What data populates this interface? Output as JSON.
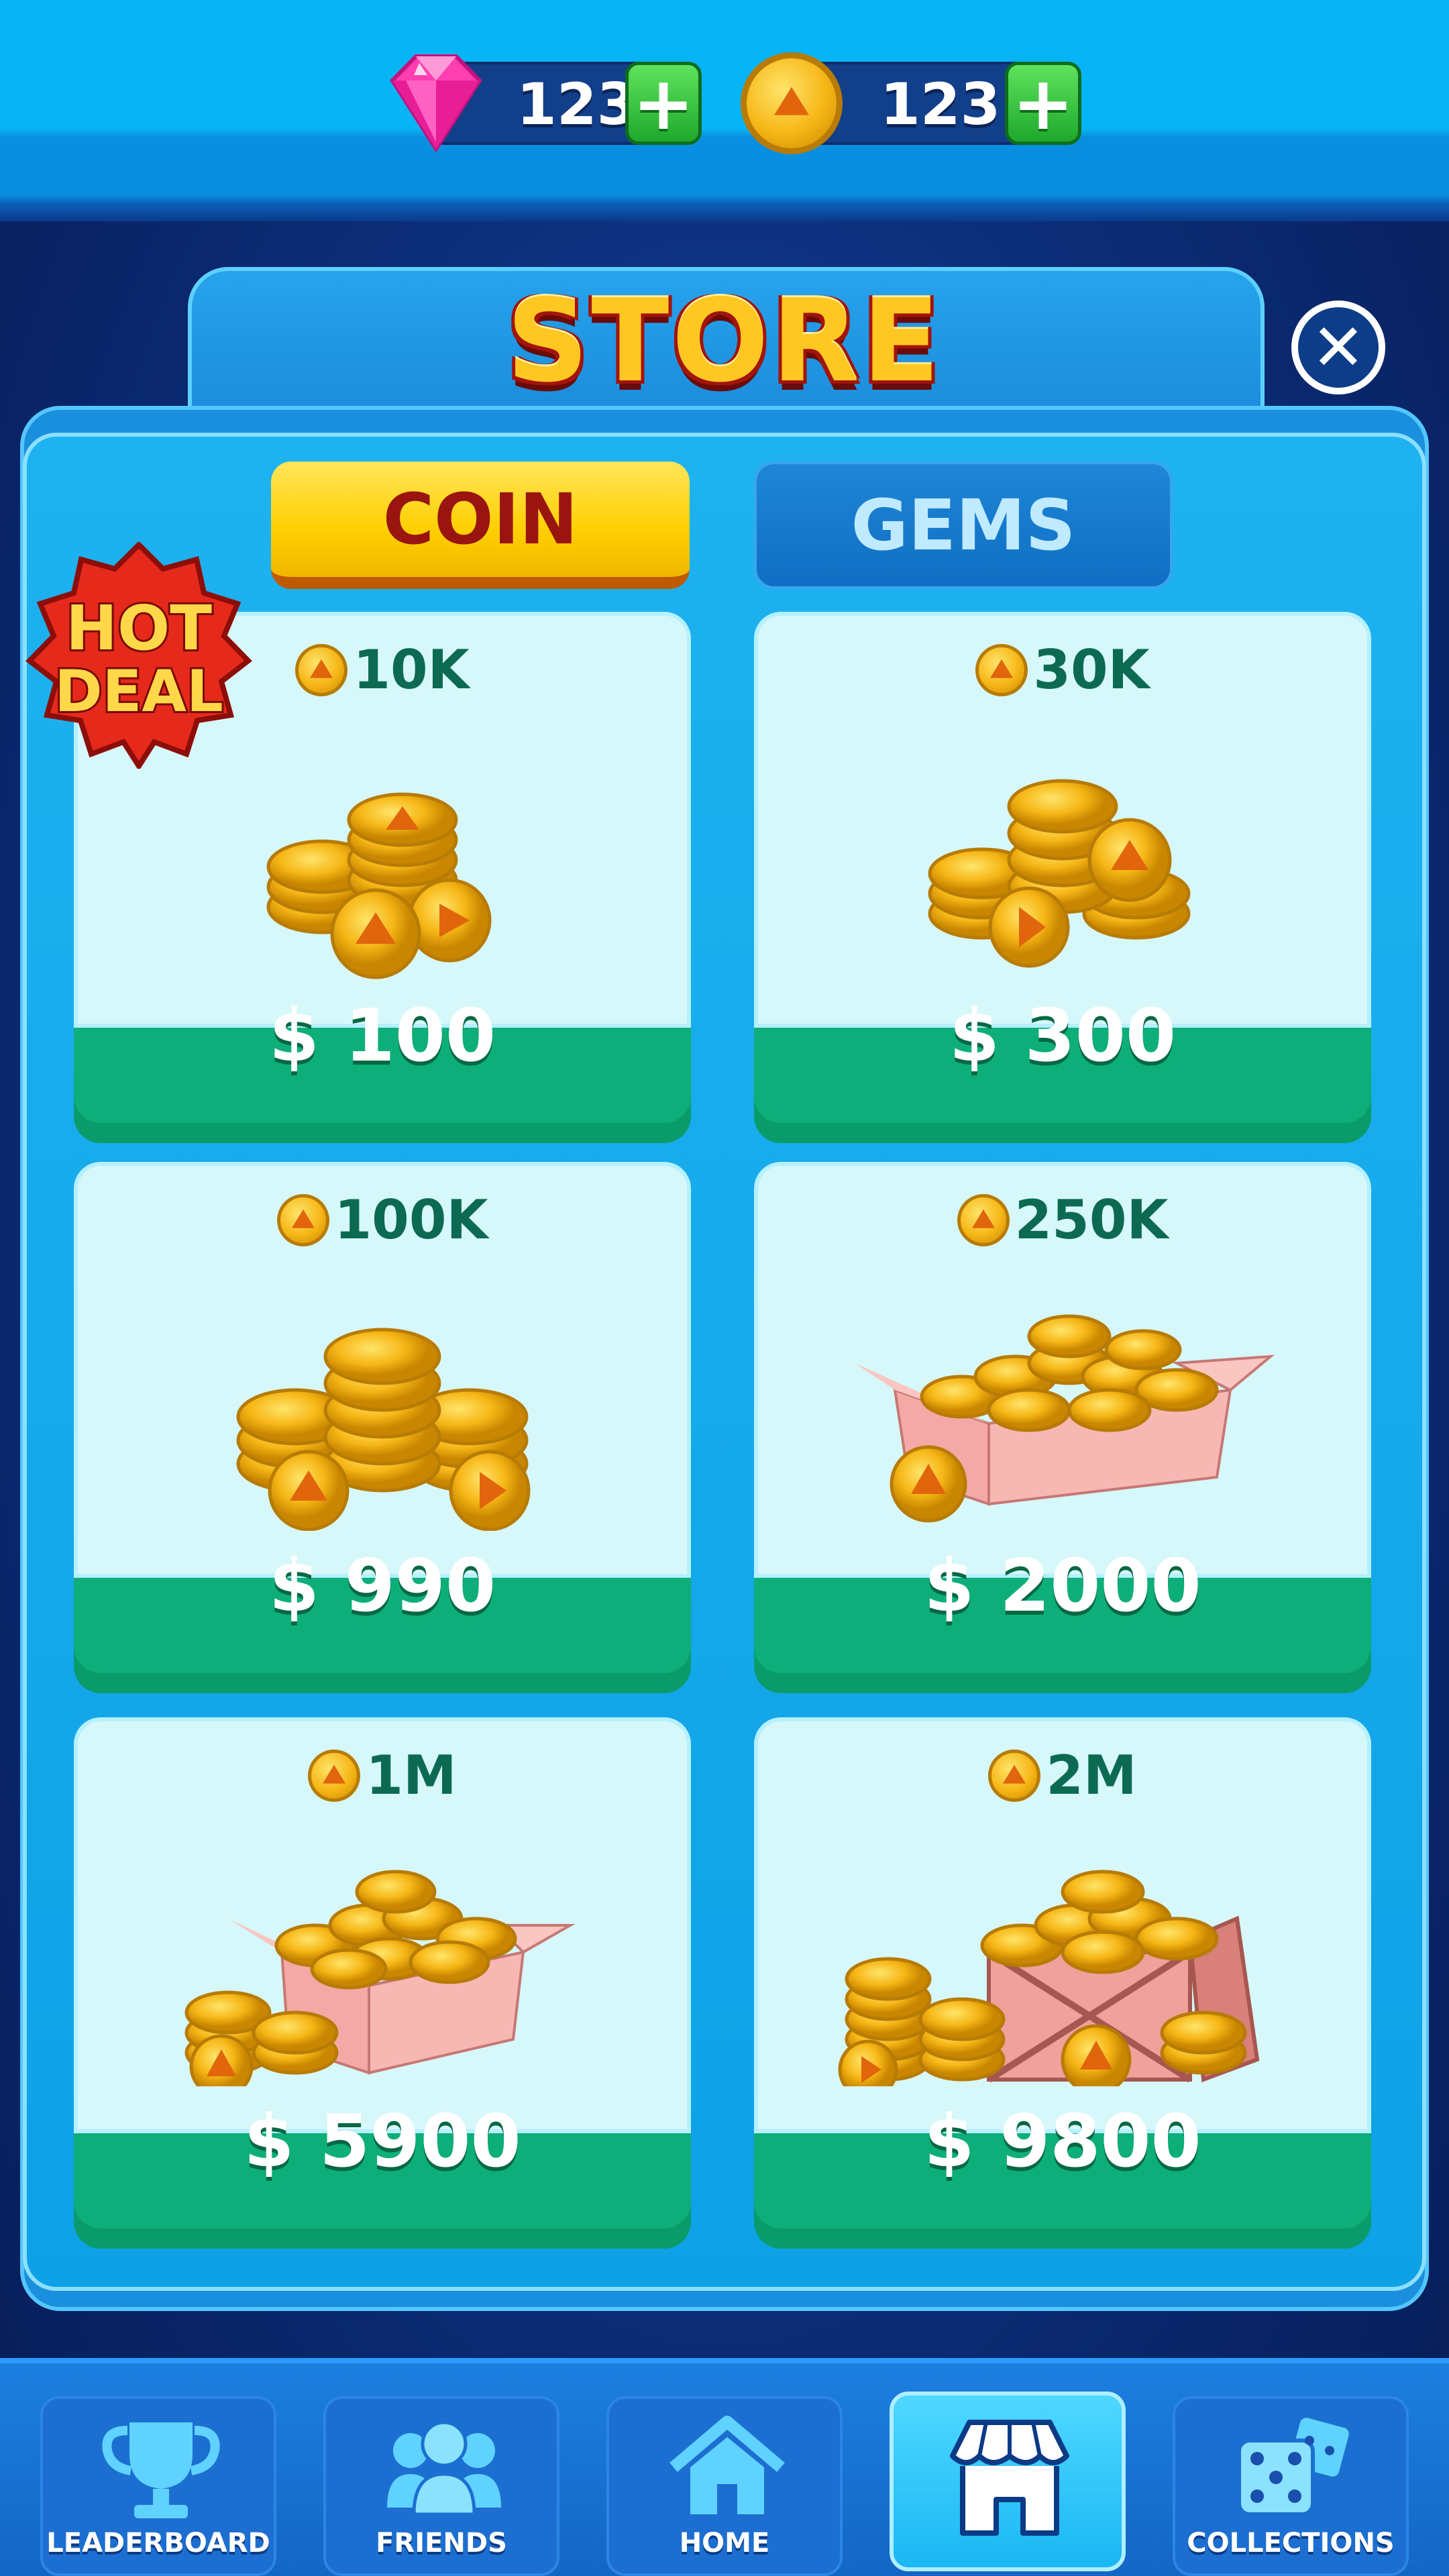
{
  "header": {
    "gems_value": "123",
    "coins_value": "123",
    "add_symbol": "+"
  },
  "store": {
    "title": "STORE",
    "close_symbol": "✕",
    "hot_deal_line1": "HOT",
    "hot_deal_line2": "DEAL",
    "tabs": [
      {
        "label": "COIN",
        "selected": true
      },
      {
        "label": "GEMS",
        "selected": false
      }
    ],
    "packs": [
      {
        "amount": "10K",
        "price": "$ 100"
      },
      {
        "amount": "30K",
        "price": "$ 300"
      },
      {
        "amount": "100K",
        "price": "$ 990"
      },
      {
        "amount": "250K",
        "price": "$ 2000"
      },
      {
        "amount": "1M",
        "price": "$ 5900"
      },
      {
        "amount": "2M",
        "price": "$ 9800"
      }
    ]
  },
  "nav": [
    {
      "label": "LEADERBOARD",
      "icon": "trophy-icon"
    },
    {
      "label": "FRIENDS",
      "icon": "friends-icon"
    },
    {
      "label": "HOME",
      "icon": "home-icon"
    },
    {
      "label": "",
      "icon": "store-icon",
      "active": true
    },
    {
      "label": "COLLECTIONS",
      "icon": "dice-icon"
    }
  ],
  "colors": {
    "coin_gold": "#f6b616",
    "price_green": "#0dae79",
    "tab_yellow": "#ffcf00",
    "panel_blue": "#1eb2f0"
  }
}
